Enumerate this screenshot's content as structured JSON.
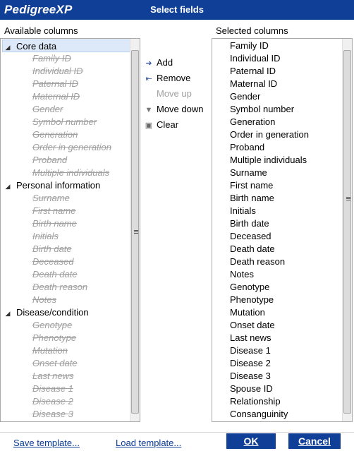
{
  "window": {
    "logo": "PedigreeXP",
    "title": "Select fields"
  },
  "available": {
    "label": "Available columns",
    "groups": [
      {
        "label": "Core data",
        "items": [
          "Family ID",
          "Individual ID",
          "Paternal ID",
          "Maternal ID",
          "Gender",
          "Symbol number",
          "Generation",
          "Order in generation",
          "Proband",
          "Multiple individuals"
        ]
      },
      {
        "label": "Personal information",
        "items": [
          "Surname",
          "First name",
          "Birth name",
          "Initials",
          "Birth date",
          "Deceased",
          "Death date",
          "Death reason",
          "Notes"
        ]
      },
      {
        "label": "Disease/condition",
        "items": [
          "Genotype",
          "Phenotype",
          "Mutation",
          "Onset date",
          "Last news",
          "Disease 1",
          "Disease 2",
          "Disease 3"
        ]
      }
    ]
  },
  "actions": {
    "add": "Add",
    "remove": "Remove",
    "move_up": "Move up",
    "move_down": "Move down",
    "clear": "Clear"
  },
  "selected": {
    "label": "Selected columns",
    "items": [
      "Family ID",
      "Individual ID",
      "Paternal ID",
      "Maternal ID",
      "Gender",
      "Symbol number",
      "Generation",
      "Order in generation",
      "Proband",
      "Multiple individuals",
      "Surname",
      "First name",
      "Birth name",
      "Initials",
      "Birth date",
      "Deceased",
      "Death date",
      "Death reason",
      "Notes",
      "Genotype",
      "Phenotype",
      "Mutation",
      "Onset date",
      "Last news",
      "Disease 1",
      "Disease 2",
      "Disease 3",
      "Spouse ID",
      "Relationship",
      "Consanguinity"
    ]
  },
  "footer": {
    "save_template": "Save template...",
    "load_template": "Load template...",
    "ok": "OK",
    "cancel": "Cancel"
  }
}
